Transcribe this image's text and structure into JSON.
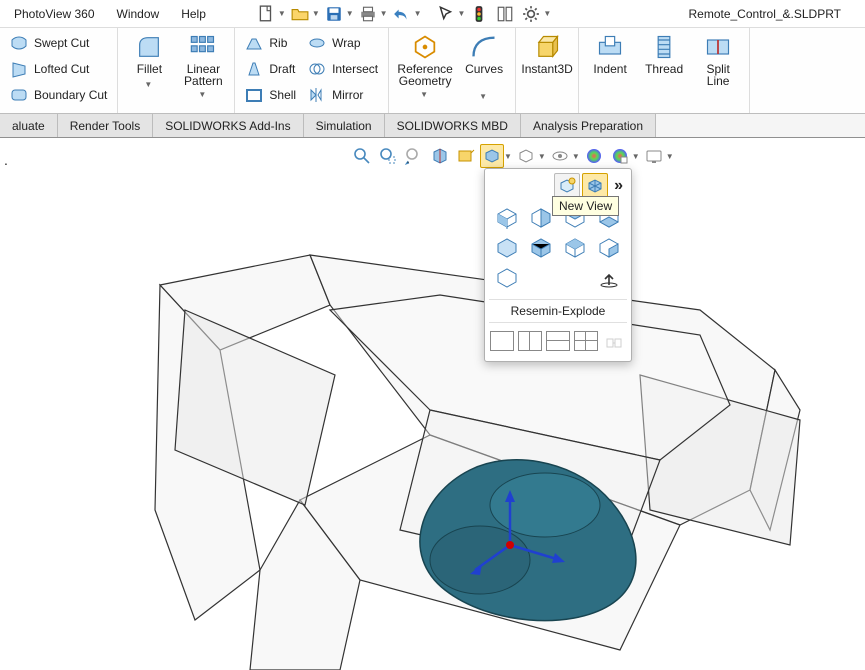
{
  "doc_title": "Remote_Control_&.SLDPRT",
  "menu": {
    "m1": "PhotoView 360",
    "m2": "Window",
    "m3": "Help"
  },
  "ribbon": {
    "swept_cut": "Swept Cut",
    "lofted_cut": "Lofted Cut",
    "boundary_cut": "Boundary Cut",
    "fillet": "Fillet",
    "linear_pattern": "Linear\nPattern",
    "rib": "Rib",
    "draft": "Draft",
    "shell": "Shell",
    "wrap": "Wrap",
    "intersect": "Intersect",
    "mirror": "Mirror",
    "ref_geom": "Reference\nGeometry",
    "curves": "Curves",
    "instant3d": "Instant3D",
    "indent": "Indent",
    "thread": "Thread",
    "split_line": "Split\nLine"
  },
  "tabs": {
    "t1": "aluate",
    "t2": "Render Tools",
    "t3": "SOLIDWORKS Add-Ins",
    "t4": "Simulation",
    "t5": "SOLIDWORKS MBD",
    "t6": "Analysis Preparation"
  },
  "orient": {
    "tooltip": "New View",
    "saved_view": "Resemin-Explode"
  }
}
